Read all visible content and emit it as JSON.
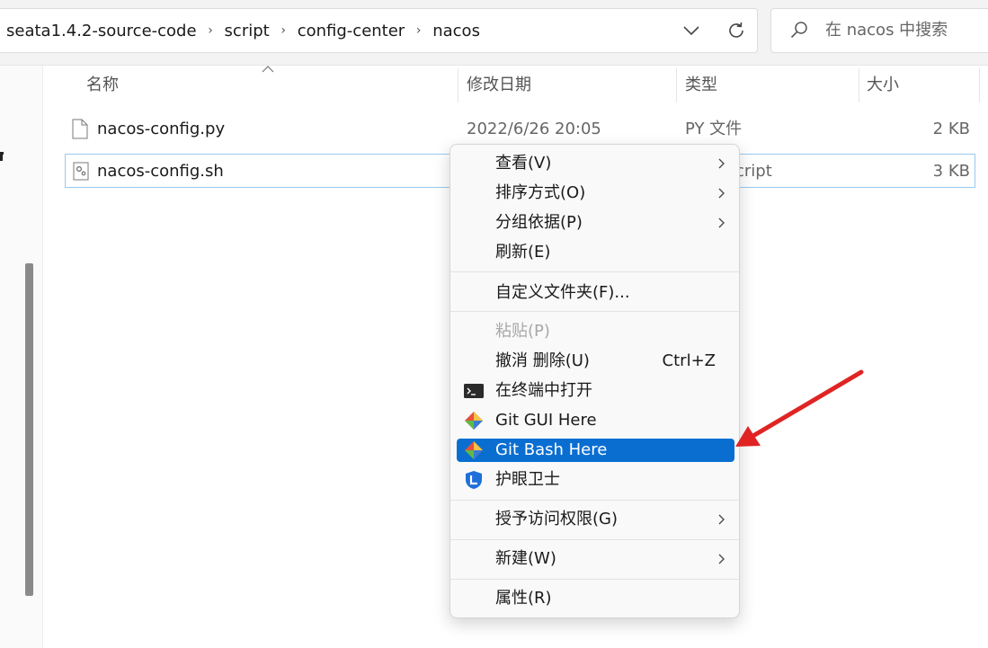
{
  "address_bar": {
    "breadcrumbs": [
      "seata1.4.2-source-code",
      "script",
      "config-center",
      "nacos"
    ]
  },
  "search": {
    "placeholder": "在 nacos 中搜索"
  },
  "columns": {
    "name": "名称",
    "modified": "修改日期",
    "type": "类型",
    "size": "大小"
  },
  "files": [
    {
      "name": "nacos-config.py",
      "modified": "2022/6/26 20:05",
      "type": "PY 文件",
      "size": "2 KB",
      "icon": "document-icon"
    },
    {
      "name": "nacos-config.sh",
      "modified": "",
      "type": "cript",
      "size": "3 KB",
      "icon": "script-file-icon"
    }
  ],
  "context_menu": {
    "view": "查看(V)",
    "sort_by": "排序方式(O)",
    "group_by": "分组依据(P)",
    "refresh": "刷新(E)",
    "customize_folder": "自定义文件夹(F)...",
    "paste": "粘贴(P)",
    "undo_delete": "撤消 删除(U)",
    "undo_shortcut": "Ctrl+Z",
    "open_in_terminal": "在终端中打开",
    "git_gui": "Git GUI Here",
    "git_bash": "Git Bash Here",
    "eye_guard": "护眼卫士",
    "give_access": "授予访问权限(G)",
    "new": "新建(W)",
    "properties": "属性(R)"
  },
  "colors": {
    "highlight": "#0a6ed1",
    "selection_border": "#99c9ef",
    "annotation_arrow": "#e02424"
  }
}
